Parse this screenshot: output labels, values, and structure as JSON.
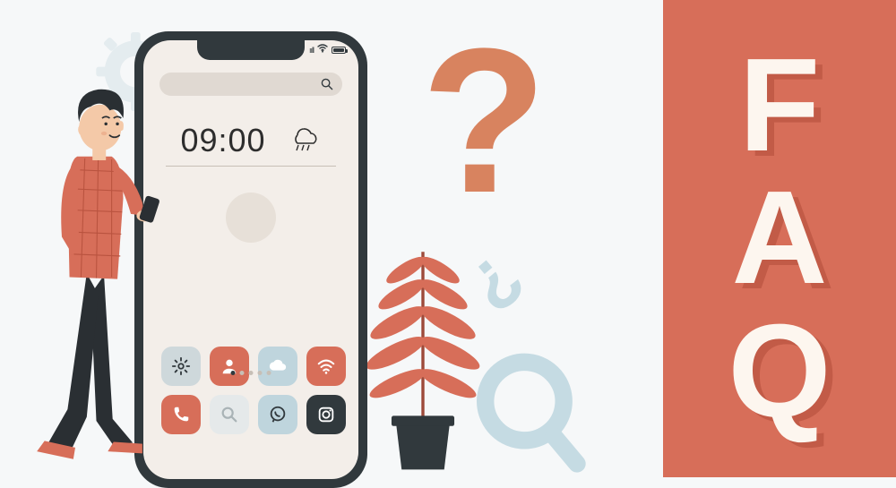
{
  "faq": {
    "f": "F",
    "a": "A",
    "q": "Q"
  },
  "big_question": "?",
  "small_question": "?",
  "phone": {
    "time": "09:00",
    "signal": "ııll",
    "search_placeholder": "",
    "apps": {
      "row1": [
        "settings-icon",
        "user-icon",
        "cloud-icon",
        "wifi-icon"
      ],
      "row2": [
        "phone-icon",
        "search-icon",
        "whatsapp-icon",
        "instagram-icon"
      ]
    }
  },
  "colors": {
    "coral": "#d76e59",
    "pale": "#c5dbe3",
    "bg": "#f6f8f9"
  }
}
